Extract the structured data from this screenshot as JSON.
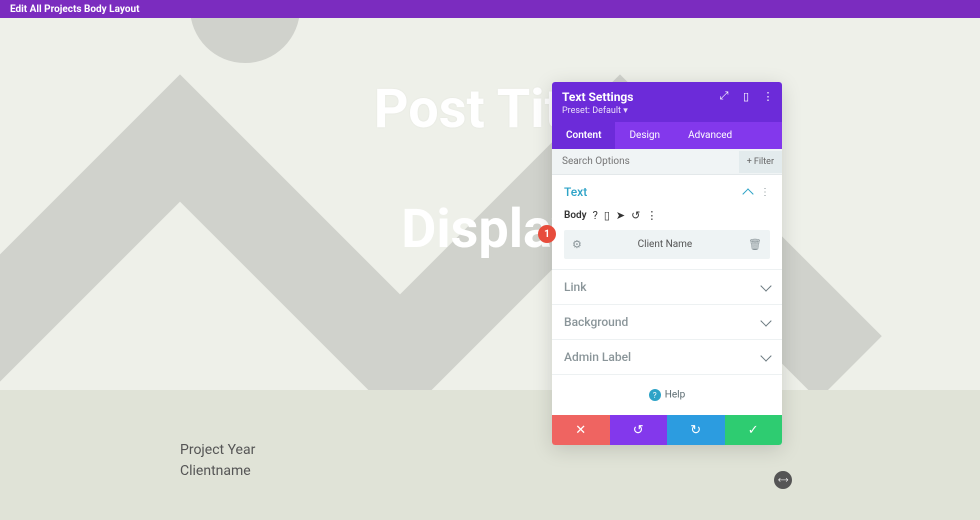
{
  "topbar": {
    "title": "Edit All Projects Body Layout"
  },
  "hero": {
    "title": "Post Title",
    "subtitle": "Display "
  },
  "meta": {
    "line1": "Project Year",
    "line2": "Clientname"
  },
  "panel": {
    "title": "Text Settings",
    "preset": "Preset: Default ▾",
    "tabs": {
      "content": "Content",
      "design": "Design",
      "advanced": "Advanced"
    },
    "search": {
      "placeholder": "Search Options",
      "filter": "Filter"
    },
    "text_section": {
      "title": "Text",
      "body_label": "Body",
      "field_value": "Client Name"
    },
    "sections": {
      "link": "Link",
      "background": "Background",
      "admin": "Admin Label"
    },
    "help": "Help"
  },
  "badge": {
    "num": "1"
  }
}
